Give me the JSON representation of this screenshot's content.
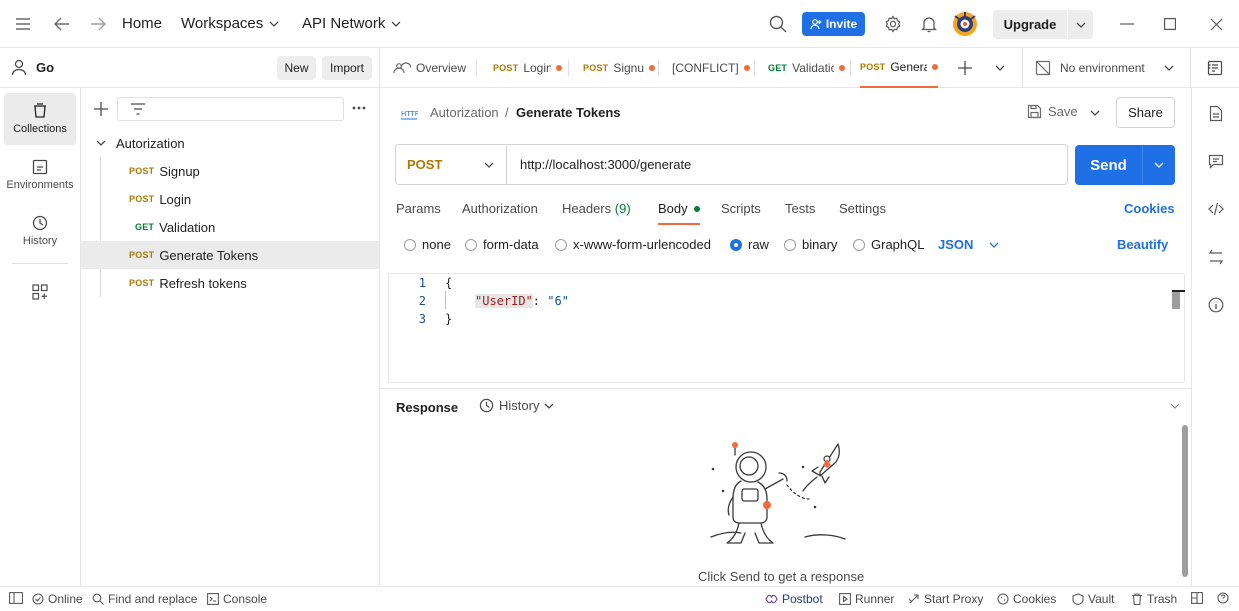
{
  "topbar": {
    "home": "Home",
    "workspaces": "Workspaces",
    "api_network": "API Network",
    "invite": "Invite",
    "upgrade": "Upgrade"
  },
  "workspace": {
    "name": "Go",
    "new_label": "New",
    "import_label": "Import"
  },
  "rail": {
    "collections": "Collections",
    "environments": "Environments",
    "history": "History"
  },
  "tabs": {
    "overview": "Overview",
    "items": [
      {
        "method": "POST",
        "label": "Login"
      },
      {
        "method": "POST",
        "label": "Signup"
      },
      {
        "method": "",
        "label": "[CONFLICT]"
      },
      {
        "method": "GET",
        "label": "Validation"
      },
      {
        "method": "POST",
        "label": "Generate"
      }
    ],
    "environment": "No environment"
  },
  "tree": {
    "folder": "Autorization",
    "items": [
      {
        "method": "POST",
        "label": "Signup"
      },
      {
        "method": "POST",
        "label": "Login"
      },
      {
        "method": "GET",
        "label": "Validation"
      },
      {
        "method": "POST",
        "label": "Generate Tokens"
      },
      {
        "method": "POST",
        "label": "Refresh tokens"
      }
    ]
  },
  "request": {
    "breadcrumb_parent": "Autorization",
    "breadcrumb_sep": "/",
    "title": "Generate Tokens",
    "http_badge": "HTTP",
    "save": "Save",
    "share": "Share",
    "method": "POST",
    "url": "http://localhost:3000/generate",
    "send": "Send",
    "tabs": {
      "params": "Params",
      "authorization": "Authorization",
      "headers": "Headers",
      "headers_count": "(9)",
      "body": "Body",
      "scripts": "Scripts",
      "tests": "Tests",
      "settings": "Settings"
    },
    "cookies": "Cookies",
    "body_types": {
      "none": "none",
      "form_data": "form-data",
      "urlencoded": "x-www-form-urlencoded",
      "raw": "raw",
      "binary": "binary",
      "graphql": "GraphQL"
    },
    "format": "JSON",
    "beautify": "Beautify",
    "code": {
      "l1": "1",
      "l2": "2",
      "l3": "3",
      "open": "{",
      "key": "\"UserID\"",
      "colon": ": ",
      "value": "\"6\"",
      "close": "}"
    }
  },
  "response": {
    "label": "Response",
    "history": "History",
    "empty": "Click Send to get a response"
  },
  "status": {
    "online": "Online",
    "find_replace": "Find and replace",
    "console": "Console",
    "postbot": "Postbot",
    "runner": "Runner",
    "start_proxy": "Start Proxy",
    "cookies": "Cookies",
    "vault": "Vault",
    "trash": "Trash"
  },
  "colors": {
    "accent": "#1f6fe5",
    "orange": "#f26b3a",
    "post": "#ad7a03",
    "get": "#007f31"
  }
}
